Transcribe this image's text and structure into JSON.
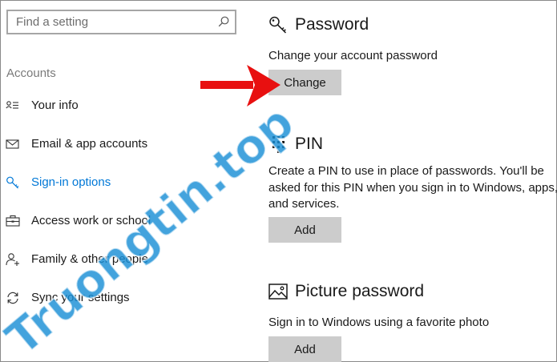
{
  "search": {
    "placeholder": "Find a setting",
    "icon": "search-icon"
  },
  "sidebar": {
    "section_label": "Accounts",
    "items": [
      {
        "label": "Your info",
        "icon": "person-card-icon",
        "active": false
      },
      {
        "label": "Email & app accounts",
        "icon": "envelope-icon",
        "active": false
      },
      {
        "label": "Sign-in options",
        "icon": "key-icon",
        "active": true
      },
      {
        "label": "Access work or school",
        "icon": "briefcase-icon",
        "active": false
      },
      {
        "label": "Family & other people",
        "icon": "add-person-icon",
        "active": false
      },
      {
        "label": "Sync your settings",
        "icon": "sync-icon",
        "active": false
      }
    ]
  },
  "main": {
    "password": {
      "title": "Password",
      "icon": "key-icon",
      "description": "Change your account password",
      "button": "Change"
    },
    "pin": {
      "title": "PIN",
      "icon": "keypad-icon",
      "description_lines": [
        "Create a PIN to use in place of passwords. You'll be",
        "asked for this PIN when you sign in to Windows, apps,",
        "and services."
      ],
      "button": "Add"
    },
    "picture_password": {
      "title": "Picture password",
      "icon": "picture-icon",
      "description": "Sign in to Windows using a favorite photo",
      "button": "Add"
    }
  },
  "overlay": {
    "watermark": "Truongtin.top",
    "arrow_color": "#e81010",
    "watermark_color": "#1a8fd6",
    "watermark_accent": "#e84e3c"
  },
  "colors": {
    "accent": "#0078d7",
    "button_bg": "#cccccc"
  }
}
